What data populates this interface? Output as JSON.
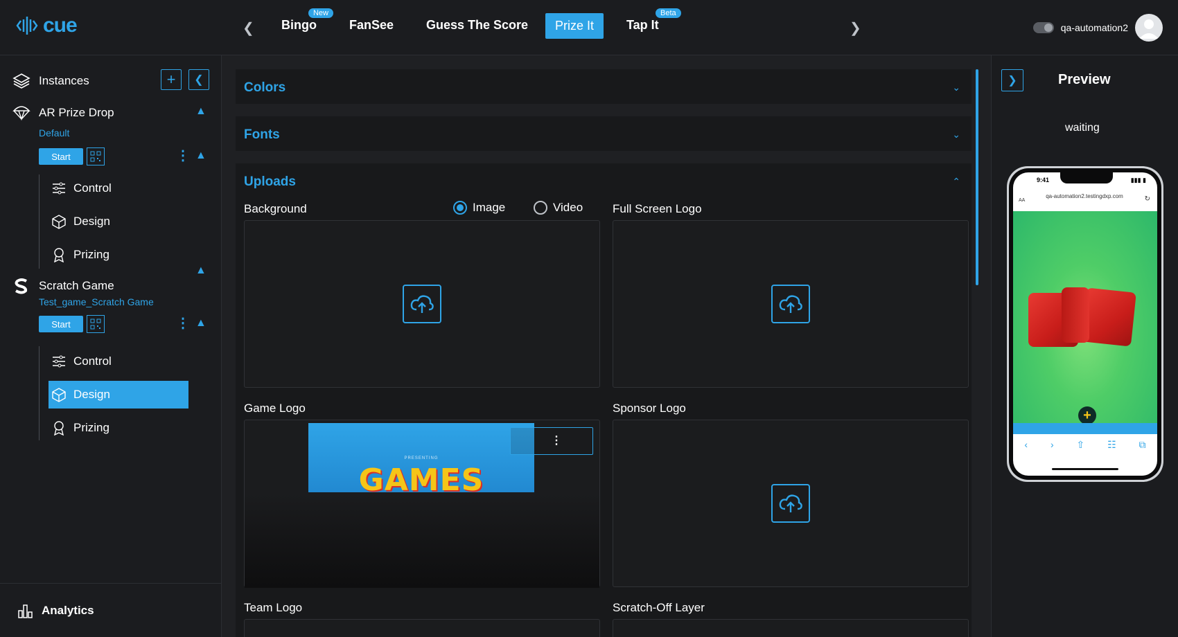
{
  "header": {
    "logo_text": "cue",
    "tabs": [
      {
        "label": "Bingo",
        "badge": "New"
      },
      {
        "label": "FanSee",
        "badge": ""
      },
      {
        "label": "Guess The Score",
        "badge": ""
      },
      {
        "label": "Prize It",
        "badge": ""
      },
      {
        "label": "Tap It",
        "badge": "Beta"
      }
    ],
    "username": "qa-automation2"
  },
  "sidebar": {
    "instances_label": "Instances",
    "games": [
      {
        "name": "AR Prize Drop",
        "instance": "Default",
        "start_label": "Start",
        "items": [
          "Control",
          "Design",
          "Prizing"
        ]
      },
      {
        "name": "Scratch Game",
        "instance": "Test_game_Scratch Game",
        "start_label": "Start",
        "items": [
          "Control",
          "Design",
          "Prizing"
        ]
      }
    ],
    "analytics_label": "Analytics"
  },
  "main": {
    "sections": [
      {
        "title": "Colors"
      },
      {
        "title": "Fonts"
      },
      {
        "title": "Uploads"
      }
    ],
    "uploads": {
      "background_label": "Background",
      "radio_image": "Image",
      "radio_video": "Video",
      "full_screen_logo_label": "Full Screen Logo",
      "game_logo_label": "Game Logo",
      "sponsor_logo_label": "Sponsor Logo",
      "team_logo_label": "Team Logo",
      "scratch_off_label": "Scratch-Off Layer",
      "game_logo_image_text": "GAMES",
      "game_logo_image_subtext": "PRESENTING"
    }
  },
  "preview": {
    "title": "Preview",
    "status": "waiting",
    "phone": {
      "time": "9:41",
      "aa": "AA",
      "url": "qa-automation2.testingdxp.com"
    }
  },
  "colors": {
    "accent": "#2fa4e7",
    "background": "#1b1c1f"
  }
}
